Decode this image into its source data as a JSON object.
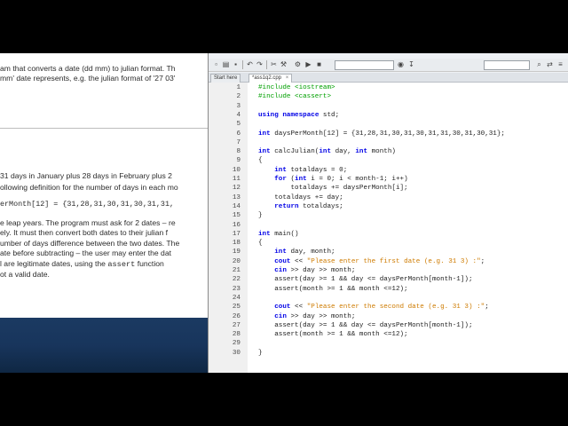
{
  "document": {
    "lines_top": [
      "am that converts a date (dd mm) to julian format. Th",
      "mm' date represents, e.g. the julian format of '27 03'"
    ],
    "lines_mid": [
      "31 days in January plus 28 days in February plus 2",
      "ollowing definition for the number of days in each mo"
    ],
    "code_line": "erMonth[12] = {31,28,31,30,31,30,31,31,",
    "lines_bottom": [
      "e leap years. The program must ask for 2 dates – re",
      "ely. It must then convert both dates to their julian f",
      "umber of days difference between the two dates. The",
      "ate before subtracting – the user may enter the dat",
      "l are legitimate dates, using the",
      "ot a valid date."
    ],
    "assert_word": "assert",
    "function_word": "function"
  },
  "ide": {
    "tabs": [
      {
        "label": "Start here",
        "active": false
      },
      {
        "label": "*ass1q2.cpp",
        "active": true
      }
    ],
    "code": [
      {
        "n": "1",
        "t": "#include <iostream>"
      },
      {
        "n": "2",
        "t": "#include <cassert>"
      },
      {
        "n": "3",
        "t": ""
      },
      {
        "n": "4",
        "t": "using namespace std;"
      },
      {
        "n": "5",
        "t": ""
      },
      {
        "n": "6",
        "t": "int daysPerMonth[12] = {31,28,31,30,31,30,31,31,30,31,30,31};"
      },
      {
        "n": "7",
        "t": ""
      },
      {
        "n": "8",
        "t": "int calcJulian(int day, int month)"
      },
      {
        "n": "9",
        "t": "{"
      },
      {
        "n": "10",
        "t": "    int totaldays = 0;"
      },
      {
        "n": "11",
        "t": "    for (int i = 0; i < month-1; i++)"
      },
      {
        "n": "12",
        "t": "        totaldays += daysPerMonth[i];"
      },
      {
        "n": "13",
        "t": "    totaldays += day;"
      },
      {
        "n": "14",
        "t": "    return totaldays;"
      },
      {
        "n": "15",
        "t": "}"
      },
      {
        "n": "16",
        "t": ""
      },
      {
        "n": "17",
        "t": "int main()"
      },
      {
        "n": "18",
        "t": "{"
      },
      {
        "n": "19",
        "t": "    int day, month;"
      },
      {
        "n": "20",
        "t": "    cout << \"Please enter the first date (e.g. 31 3) :\";"
      },
      {
        "n": "21",
        "t": "    cin >> day >> month;"
      },
      {
        "n": "22",
        "t": "    assert(day >= 1 && day <= daysPerMonth[month-1]);"
      },
      {
        "n": "23",
        "t": "    assert(month >= 1 && month <=12);"
      },
      {
        "n": "24",
        "t": ""
      },
      {
        "n": "25",
        "t": "    cout << \"Please enter the second date (e.g. 31 3) :\";"
      },
      {
        "n": "26",
        "t": "    cin >> day >> month;"
      },
      {
        "n": "27",
        "t": "    assert(day >= 1 && day <= daysPerMonth[month-1]);"
      },
      {
        "n": "28",
        "t": "    assert(month >= 1 && month <=12);"
      },
      {
        "n": "29",
        "t": ""
      },
      {
        "n": "30",
        "t": "}"
      }
    ]
  },
  "colors": {
    "keyword": "#0000e6",
    "preprocessor": "#00a000",
    "string": "#ce7b00",
    "desktop": "#18355c"
  }
}
